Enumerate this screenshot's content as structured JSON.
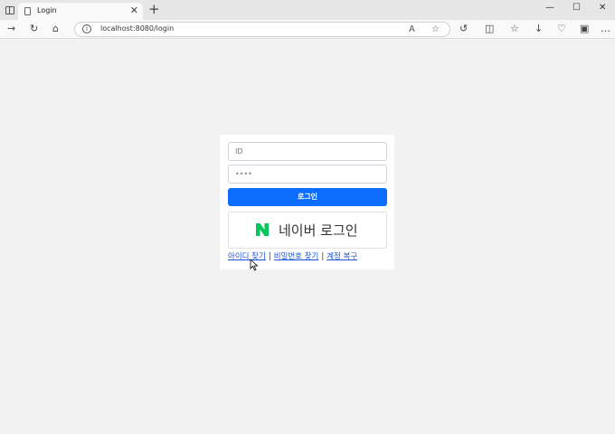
{
  "browser": {
    "tab_title": "Login",
    "tab_close": "✕",
    "new_tab": "+",
    "url": "localhost:8080/login",
    "window_controls": {
      "minimize": "—",
      "maximize": "☐",
      "close": "✕"
    }
  },
  "login": {
    "id_placeholder": "ID",
    "password_value": "****",
    "login_button": "로그인",
    "naver_button": "네이버 로그인",
    "links": {
      "find_id": "아이디 찾기",
      "find_password": "비밀번호 찾기",
      "recover_account": "계정 복구",
      "separator": "|"
    }
  },
  "colors": {
    "primary": "#0d6efd",
    "naver_green": "#03c75a",
    "link": "#1a55d6",
    "page_bg": "#f2f2f2"
  }
}
